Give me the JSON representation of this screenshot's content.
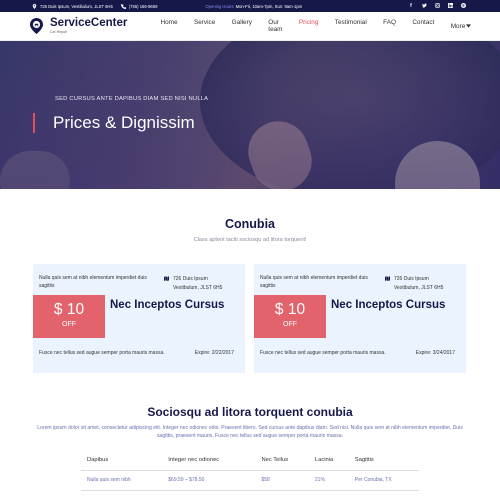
{
  "topbar": {
    "address": "726 Duis Ipsum, Vestibulum, JLST 6H5",
    "phone": "(755) 166-8669",
    "hours_label": "Opening Hours",
    "hours_value": "Mon-Fri, 10am-7pm, Sun: 9am-1pm",
    "social": [
      "facebook-icon",
      "twitter-icon",
      "instagram-icon",
      "linkedin-icon",
      "pinterest-icon"
    ]
  },
  "nav": {
    "brand": "ServiceCenter",
    "tagline": "Car Repair",
    "items": [
      {
        "label": "Home"
      },
      {
        "label": "Service"
      },
      {
        "label": "Gallery"
      },
      {
        "label": "Our team"
      },
      {
        "label": "Pricing",
        "active": true
      },
      {
        "label": "Testimonial"
      },
      {
        "label": "FAQ"
      },
      {
        "label": "Contact"
      },
      {
        "label": "More"
      }
    ],
    "accent": "#e34f5b"
  },
  "hero": {
    "subtitle": "SED CURSUS ANTE DAPIBUS DIAM SED NISI NULLA",
    "title": "Prices & Dignissim"
  },
  "section1": {
    "title": "Conubia",
    "subtitle": "Class aptent taciti sociosqu ad litora torquent!"
  },
  "cards": [
    {
      "intro": "Nulla quis sem at nibh elementum imperdiet duis sagittis",
      "address": "726 Duis Ipsum Vestibulum, JLST 6H5",
      "price": "$ 10",
      "off": "OFF",
      "name": "Nec Inceptos Cursus",
      "footer": "Fusce nec tellus sed augue semper porta mauris massa.",
      "expire": "Expire: 2/22/2017"
    },
    {
      "intro": "Nulla quis sem at nibh elementum imperdiet duis sagittis",
      "address": "726 Duis Ipsum Vestibulum, JLST 6H5",
      "price": "$ 10",
      "off": "OFF",
      "name": "Nec Inceptos Cursus",
      "footer": "Fusce nec tellus sed augue semper porta mauris massa.",
      "expire": "Expire: 3/24/2017"
    }
  ],
  "section2": {
    "title": "Sociosqu ad litora torquent conubia",
    "paragraph": "Lorem ipsum dolor sit amet, consectetur adipiscing elit. Integer nec odionec odio. Praesent libero. Sed cursus ante dapibus diam. Sed nisi. Nulla quis sem at nibh elementum imperdiet. Duis sagittis, praesent mauris. Fusce nec tellus sed augue semper porta mauris massa."
  },
  "table": {
    "headers": [
      "Dapibus",
      "Integer nec odionec",
      "Nec Tellus",
      "Lacinia",
      "Sagittis"
    ],
    "rows": [
      [
        "Nulla quis sem nibh",
        "$69.59 – $78.50",
        "$58",
        "21%",
        "Per Conubia, TX"
      ]
    ]
  }
}
